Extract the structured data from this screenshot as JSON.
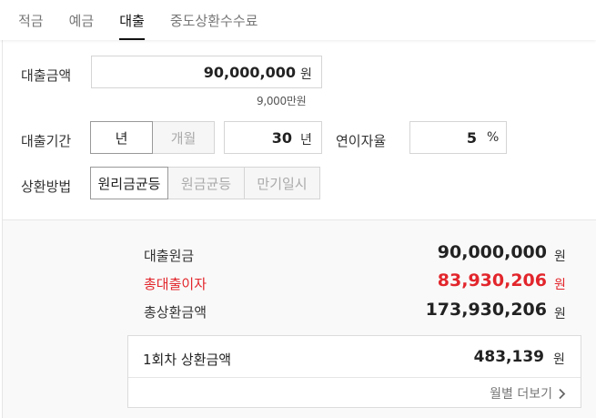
{
  "tabs": [
    {
      "label": "적금",
      "active": false
    },
    {
      "label": "예금",
      "active": false
    },
    {
      "label": "대출",
      "active": true
    },
    {
      "label": "중도상환수수료",
      "active": false
    }
  ],
  "form": {
    "loan_amount": {
      "label": "대출금액",
      "value": "90,000,000",
      "unit": "원",
      "hint": "9,000만원"
    },
    "loan_period": {
      "label": "대출기간",
      "options": [
        "년",
        "개월"
      ],
      "selected": "년",
      "value": "30",
      "unit": "년"
    },
    "interest_rate": {
      "label": "연이자율",
      "value": "5",
      "unit": "%"
    },
    "repayment": {
      "label": "상환방법",
      "options": [
        "원리금균등",
        "원금균등",
        "만기일시"
      ],
      "selected": "원리금균등"
    }
  },
  "results": {
    "principal": {
      "label": "대출원금",
      "value": "90,000,000",
      "unit": "원"
    },
    "total_interest": {
      "label": "총대출이자",
      "value": "83,930,206",
      "unit": "원"
    },
    "total_repayment": {
      "label": "총상환금액",
      "value": "173,930,206",
      "unit": "원"
    },
    "first_payment": {
      "label": "1회차 상환금액",
      "value": "483,139",
      "unit": "원"
    },
    "monthly_link": "월별 더보기"
  },
  "colors": {
    "accent_red": "#e2262c",
    "text": "#333333"
  }
}
